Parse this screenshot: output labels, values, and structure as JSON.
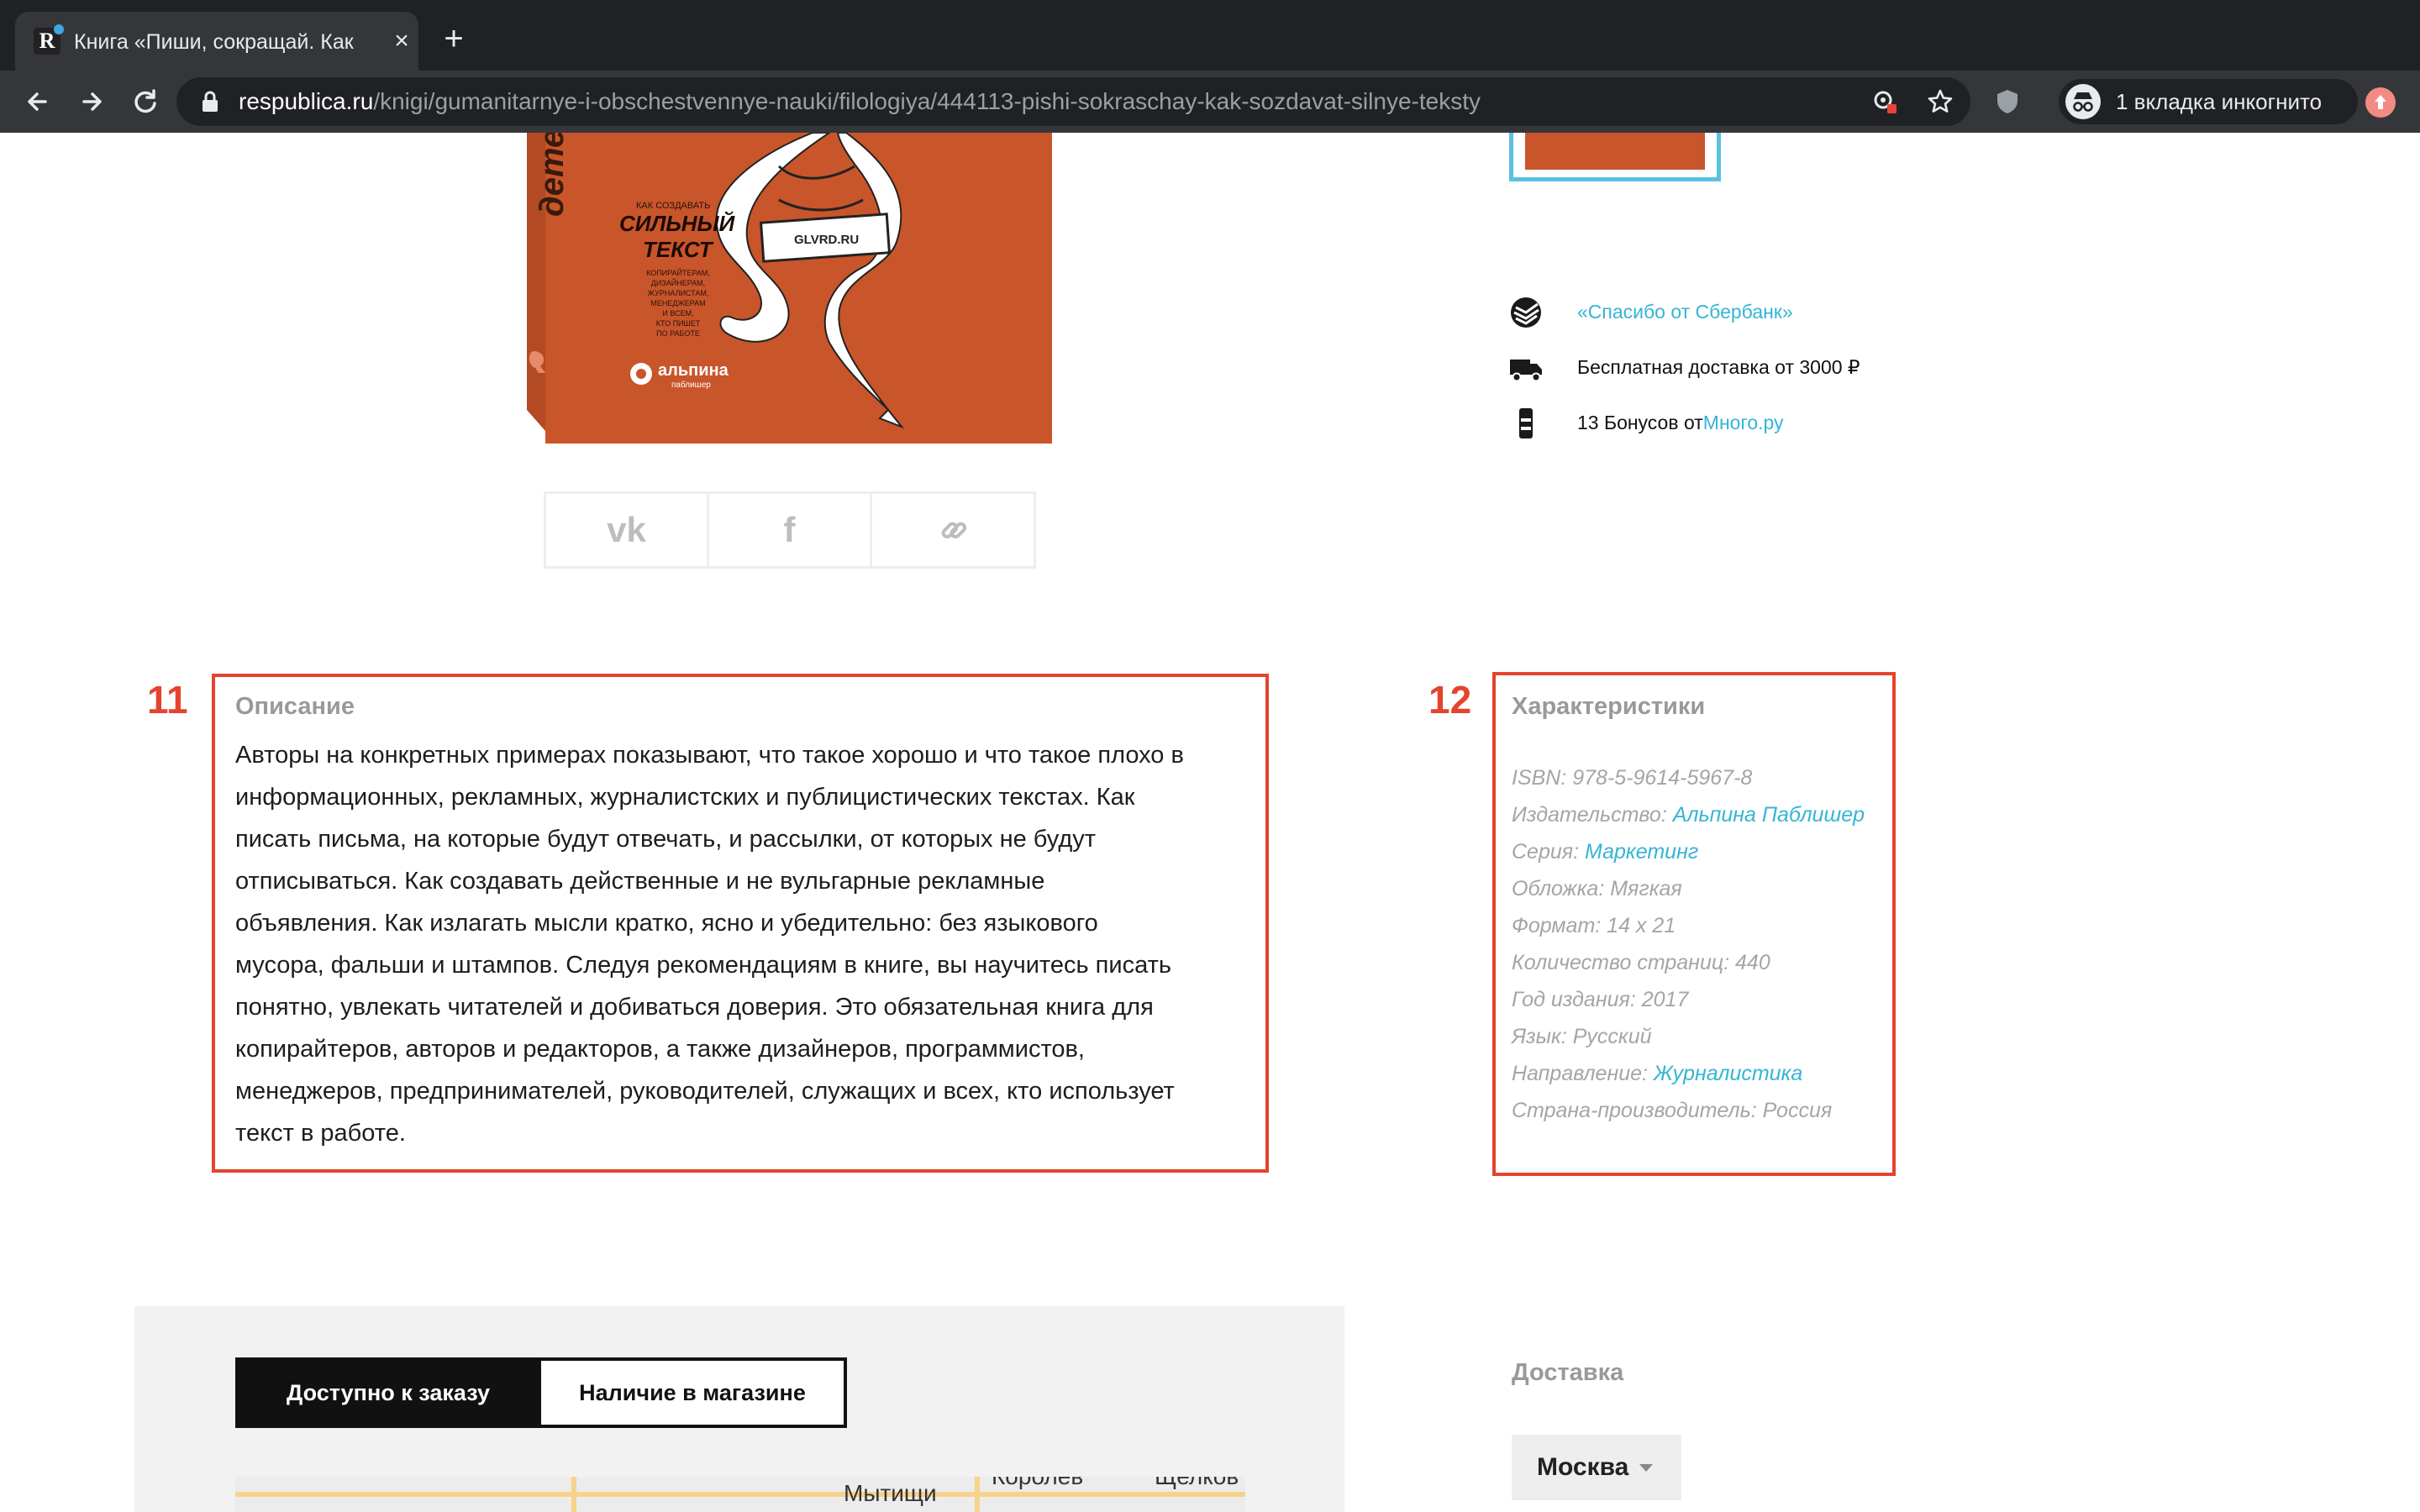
{
  "browser": {
    "tab_title": "Книга «Пиши, сокращай. Как",
    "tab_favicon_letter": "R",
    "url_host": "respublica.ru",
    "url_path": "/knigi/gumanitarnye-i-obschestvennye-nauki/filologiya/444113-pishi-sokraschay-kak-sozdavat-silnye-teksty",
    "incognito_label": "1 вкладка инкогнито"
  },
  "book_cover": {
    "spine_text": "детерд",
    "small_title": "КАК СОЗДАВАТЬ",
    "title_line1": "СИЛЬНЫЙ",
    "title_line2": "ТЕКСТ",
    "subtitle_lines": [
      "КОПИРАЙТЕРАМ,",
      "ДИЗАЙНЕРАМ,",
      "ЖУРНАЛИСТАМ,",
      "МЕНЕДЖЕРАМ",
      "И ВСЕМ,",
      "КТО ПИШЕТ",
      "ПО РАБОТЕ"
    ],
    "sign_text": "GLVRD.RU",
    "publisher_line1": "альпина",
    "publisher_line2": "паблишер",
    "colors": {
      "cover": "#c9552b",
      "spine": "#b34a23"
    }
  },
  "share": {
    "vk_icon": "vk-icon",
    "fb_icon": "facebook-icon",
    "link_icon": "link-icon"
  },
  "perks": {
    "sber_link": "«Спасибо от Сбербанк»",
    "delivery_text": "Бесплатная доставка от 3000 ₽",
    "bonus_text": "13 Бонусов от",
    "bonus_link": "Много.ру"
  },
  "annotations": {
    "marker_description": "11",
    "marker_specs": "12",
    "color": "#e5432e"
  },
  "description": {
    "title": "Описание",
    "lines": [
      "Авторы на конкретных примерах показывают, что такое хорошо и что такое плохо в",
      "информационных, рекламных, журналистских и публицистических текстах. Как",
      "писать письма, на которые будут отвечать, и рассылки, от которых не будут",
      "отписываться. Как создавать действенные и не вульгарные рекламные",
      "объявления. Как излагать мысли кратко, ясно и убедительно: без языкового",
      "мусора, фальши и штампов. Следуя рекомендациям в книге, вы научитесь писать",
      "понятно, увлекать читателей и добиваться доверия. Это обязательная книга для",
      "копирайтеров, авторов и редакторов, а также дизайнеров, программистов,",
      "менеджеров, предпринимателей, руководителей, служащих и всех, кто использует",
      "текст в работе."
    ]
  },
  "specs": {
    "title": "Характеристики",
    "isbn": "ISBN: 978-5-9614-5967-8",
    "publisher_label": "Издательство: ",
    "publisher_value": "Альпина Паблишер",
    "series_label": "Серия: ",
    "series_value": "Маркетинг",
    "cover": "Обложка: Мягкая",
    "format": "Формат: 14 x 21",
    "pages": "Количество страниц: 440",
    "year": "Год издания: 2017",
    "language": "Язык: Русский",
    "direction_label": "Направление: ",
    "direction_value": "Журналистика",
    "country": "Страна-производитель: Россия"
  },
  "availability": {
    "tab_order": "Доступно к заказу",
    "tab_store": "Наличие в магазине",
    "map_labels": [
      "Королев",
      "Мытищи",
      "Щелков"
    ]
  },
  "delivery": {
    "title": "Доставка",
    "city": "Москва"
  }
}
